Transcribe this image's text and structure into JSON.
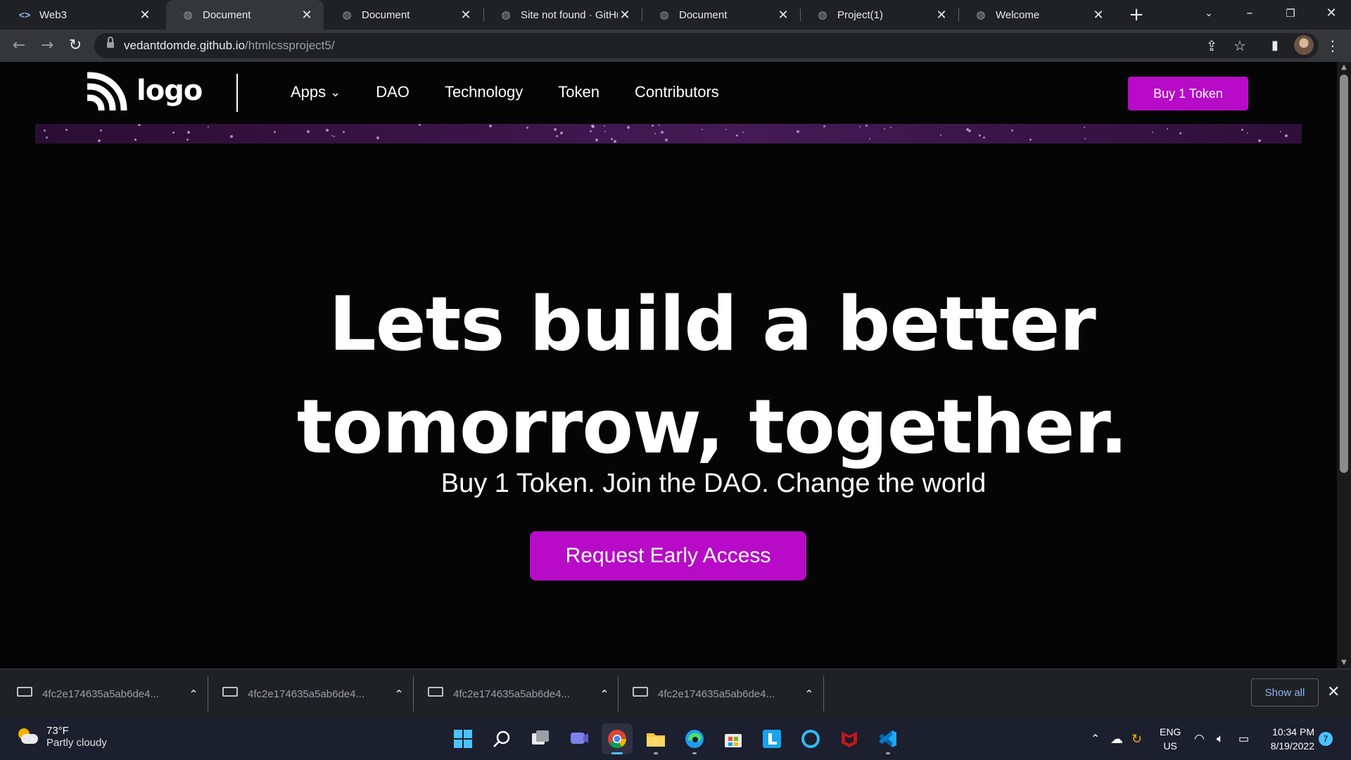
{
  "browser": {
    "tabs": [
      {
        "title": "Web3",
        "icon": "code-icon"
      },
      {
        "title": "Document",
        "icon": "globe-icon",
        "active": true
      },
      {
        "title": "Document",
        "icon": "globe-icon"
      },
      {
        "title": "Site not found · GitHu",
        "icon": "globe-icon"
      },
      {
        "title": "Document",
        "icon": "globe-icon"
      },
      {
        "title": "Project(1)",
        "icon": "globe-icon"
      },
      {
        "title": "Welcome",
        "icon": "globe-icon"
      }
    ],
    "url_host": "vedantdomde.github.io",
    "url_path": "/htmlcssproject5/"
  },
  "site": {
    "logo_text": "logo",
    "nav": [
      "Apps",
      "DAO",
      "Technology",
      "Token",
      "Contributors"
    ],
    "buy_button": "Buy 1 Token",
    "hero_line1": "Lets build a better",
    "hero_line2": "tomorrow, together.",
    "hero_sub": "Buy 1 Token. Join the DAO. Change the world",
    "cta": "Request Early Access",
    "accent_color": "#b70bc7"
  },
  "downloads": {
    "items": [
      "4fc2e174635a5ab6de4...",
      "4fc2e174635a5ab6de4...",
      "4fc2e174635a5ab6de4...",
      "4fc2e174635a5ab6de4..."
    ],
    "show_all": "Show all"
  },
  "taskbar": {
    "temperature": "73°F",
    "condition": "Partly cloudy",
    "lang_top": "ENG",
    "lang_bottom": "US",
    "time": "10:34 PM",
    "date": "8/19/2022",
    "notification_count": "7"
  }
}
